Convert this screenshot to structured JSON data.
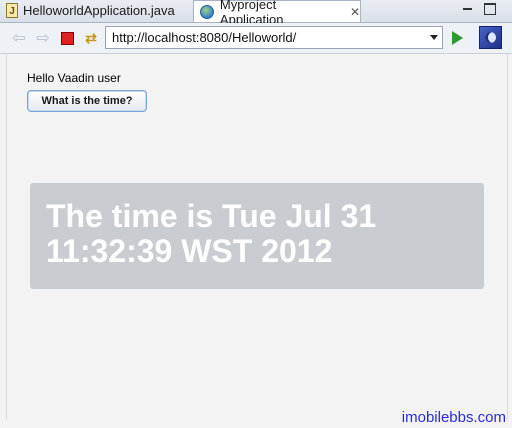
{
  "tabs": [
    {
      "label": "HelloworldApplication.java",
      "icon": "java-file-icon"
    },
    {
      "label": "Myproject Application",
      "icon": "globe-icon",
      "close": "✕"
    }
  ],
  "toolbar": {
    "url": "http://localhost:8080/Helloworld/"
  },
  "main": {
    "greeting": "Hello Vaadin user",
    "time_button_label": "What is the time?",
    "time_text": "The time is Tue Jul 31 11:32:39 WST 2012"
  },
  "watermark": "imobilebbs.com"
}
